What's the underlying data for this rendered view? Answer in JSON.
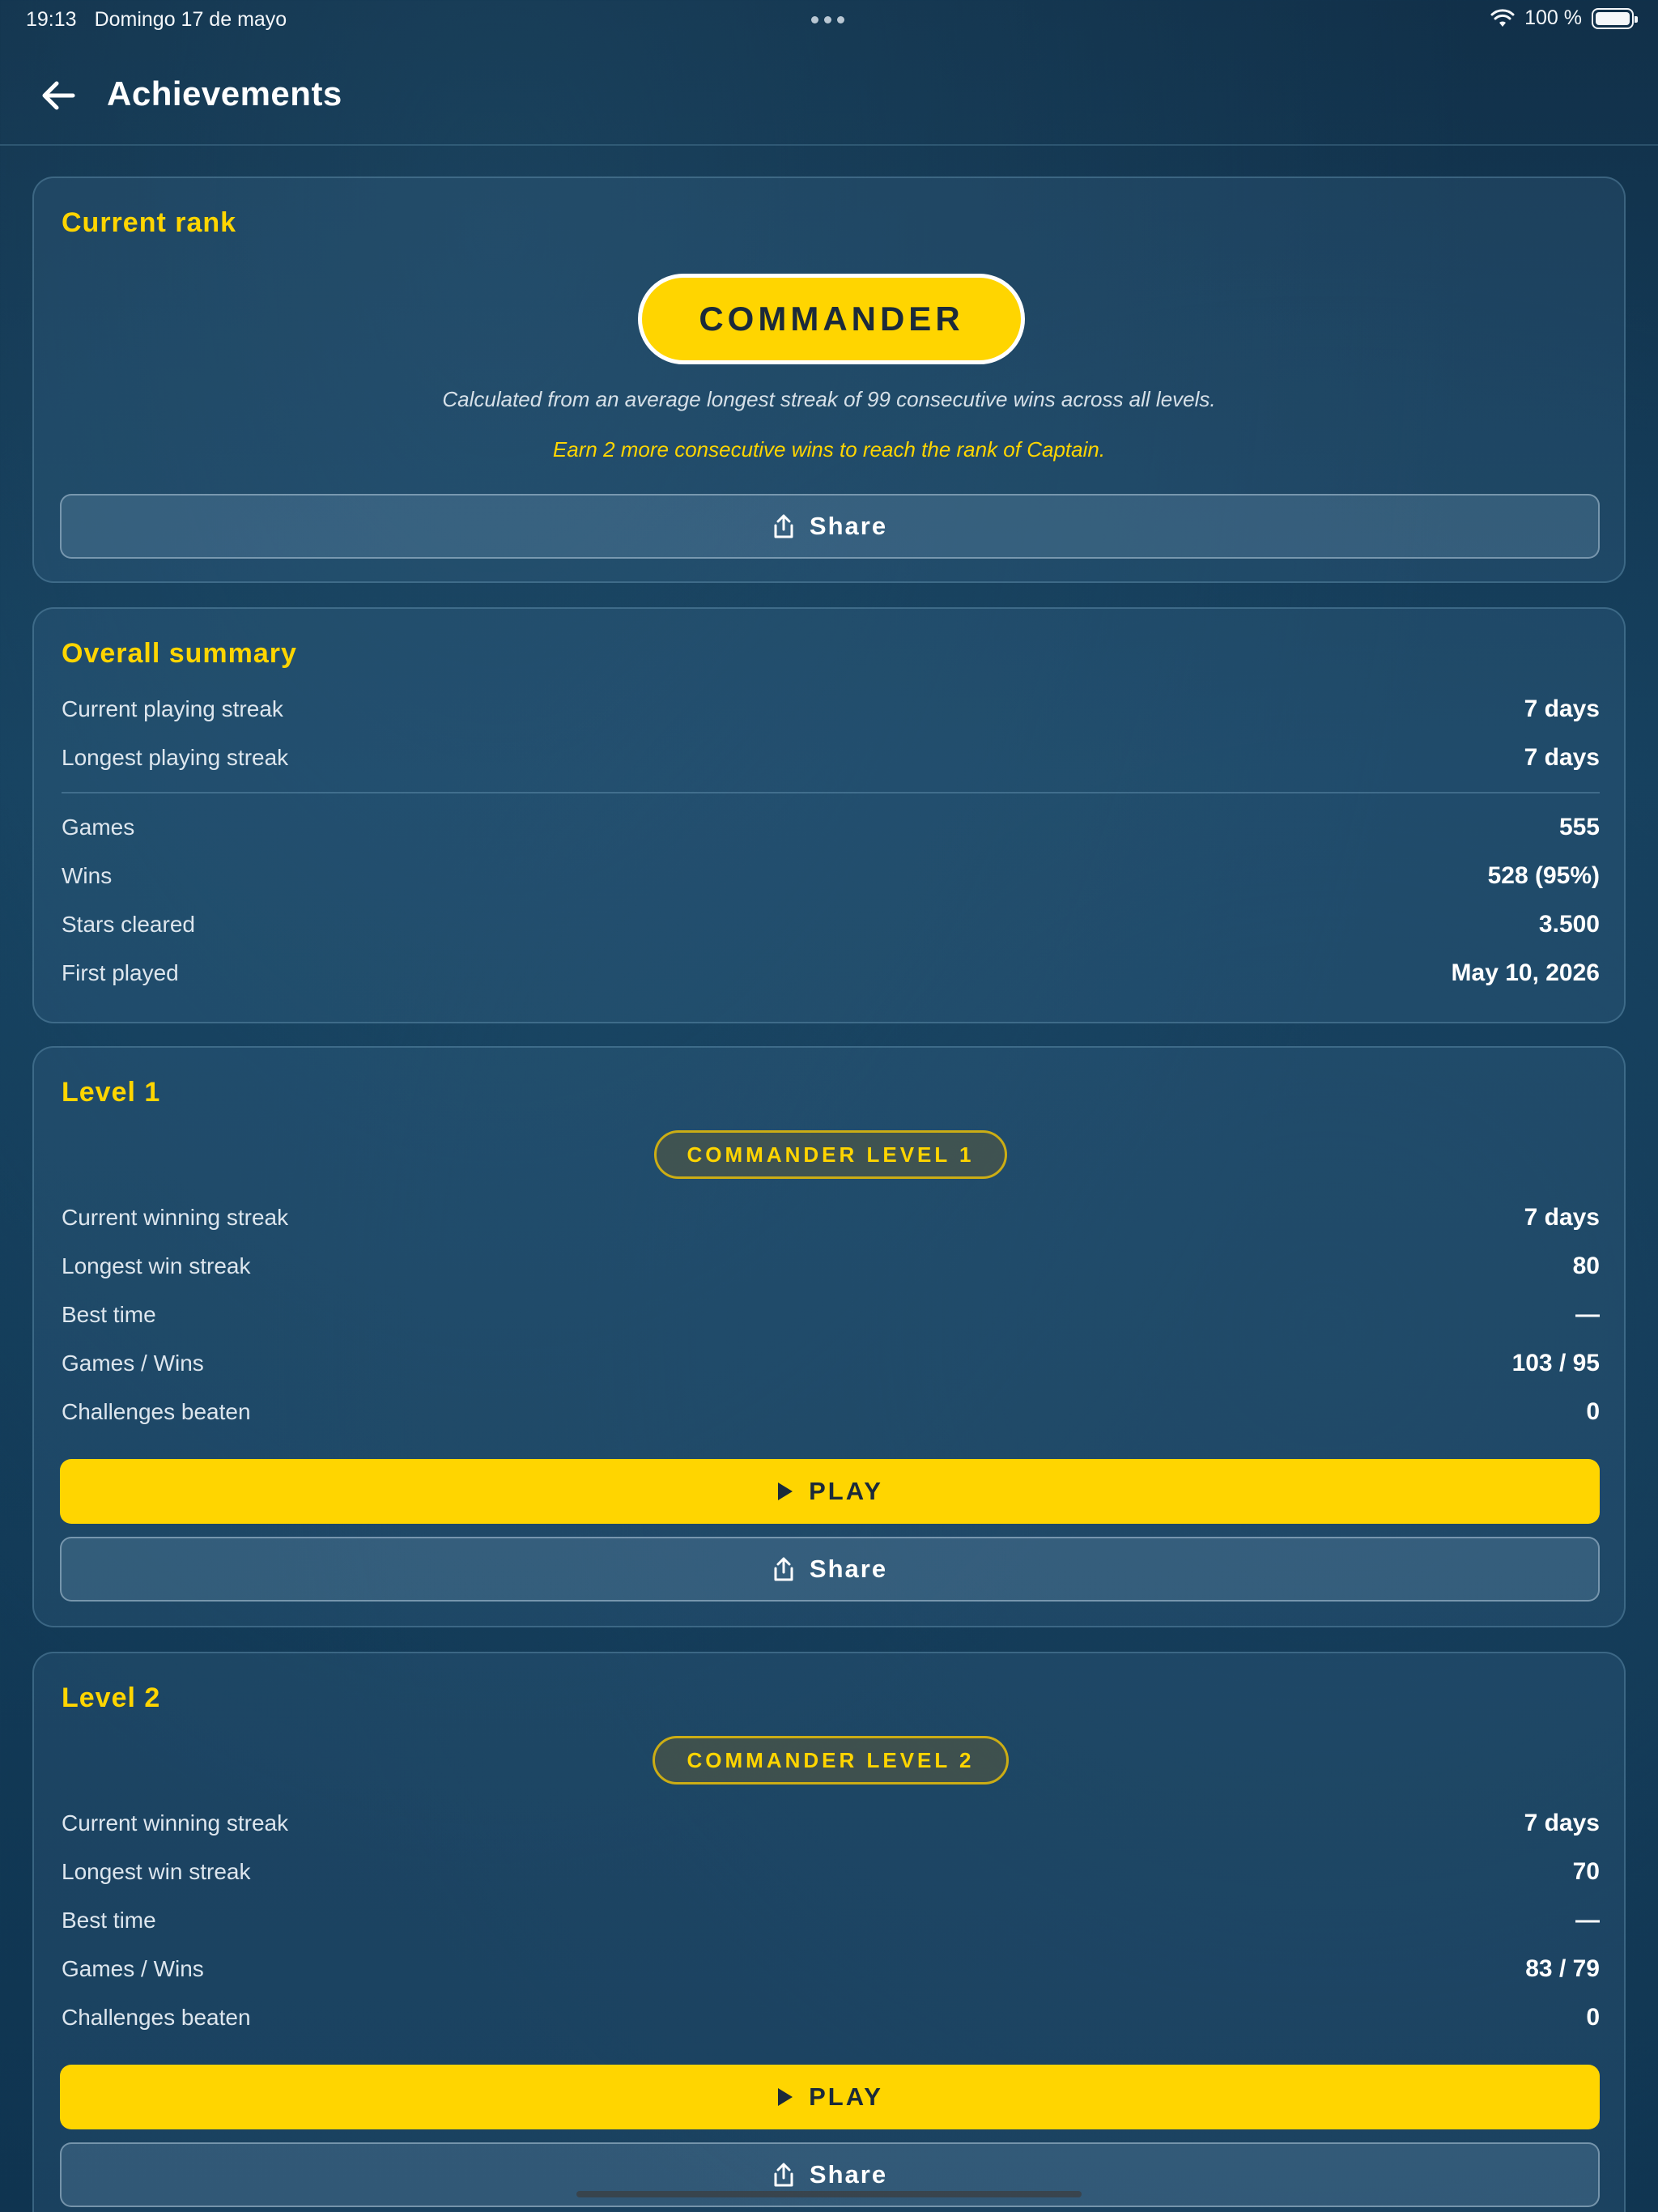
{
  "status_bar": {
    "time": "19:13",
    "date": "Domingo 17 de mayo",
    "battery": "100 %"
  },
  "header": {
    "title": "Achievements",
    "back_icon": "arrow-left-icon"
  },
  "rank_card": {
    "title": "Current rank",
    "rank": "COMMANDER",
    "description": "Calculated from an average longest streak of 99 consecutive wins across all levels.",
    "next_rank_hint": "Earn 2 more consecutive wins to reach the rank of Captain.",
    "share_label": "Share"
  },
  "summary_card": {
    "title": "Overall summary",
    "rows_top": [
      {
        "label": "Current playing streak",
        "value": "7 days"
      },
      {
        "label": "Longest playing streak",
        "value": "7 days"
      }
    ],
    "rows_bottom": [
      {
        "label": "Games",
        "value": "555"
      },
      {
        "label": "Wins",
        "value": "528 (95%)"
      },
      {
        "label": "Stars cleared",
        "value": "3.500"
      },
      {
        "label": "First played",
        "value": "May 10, 2026"
      }
    ]
  },
  "levels": [
    {
      "title": "Level 1",
      "badge": "COMMANDER LEVEL 1",
      "rows": [
        {
          "label": "Current winning streak",
          "value": "7 days"
        },
        {
          "label": "Longest win streak",
          "value": "80"
        },
        {
          "label": "Best time",
          "value": "—"
        },
        {
          "label": "Games / Wins",
          "value": "103 / 95"
        },
        {
          "label": "Challenges beaten",
          "value": "0"
        }
      ],
      "play_label": "PLAY",
      "share_label": "Share"
    },
    {
      "title": "Level 2",
      "badge": "COMMANDER LEVEL 2",
      "rows": [
        {
          "label": "Current winning streak",
          "value": "7 days"
        },
        {
          "label": "Longest win streak",
          "value": "70"
        },
        {
          "label": "Best time",
          "value": "—"
        },
        {
          "label": "Games / Wins",
          "value": "83 / 79"
        },
        {
          "label": "Challenges beaten",
          "value": "0"
        }
      ],
      "play_label": "PLAY",
      "share_label": "Share"
    }
  ],
  "colors": {
    "accent": "#ffd500",
    "background": "#15405e",
    "text": "#ffffff"
  }
}
